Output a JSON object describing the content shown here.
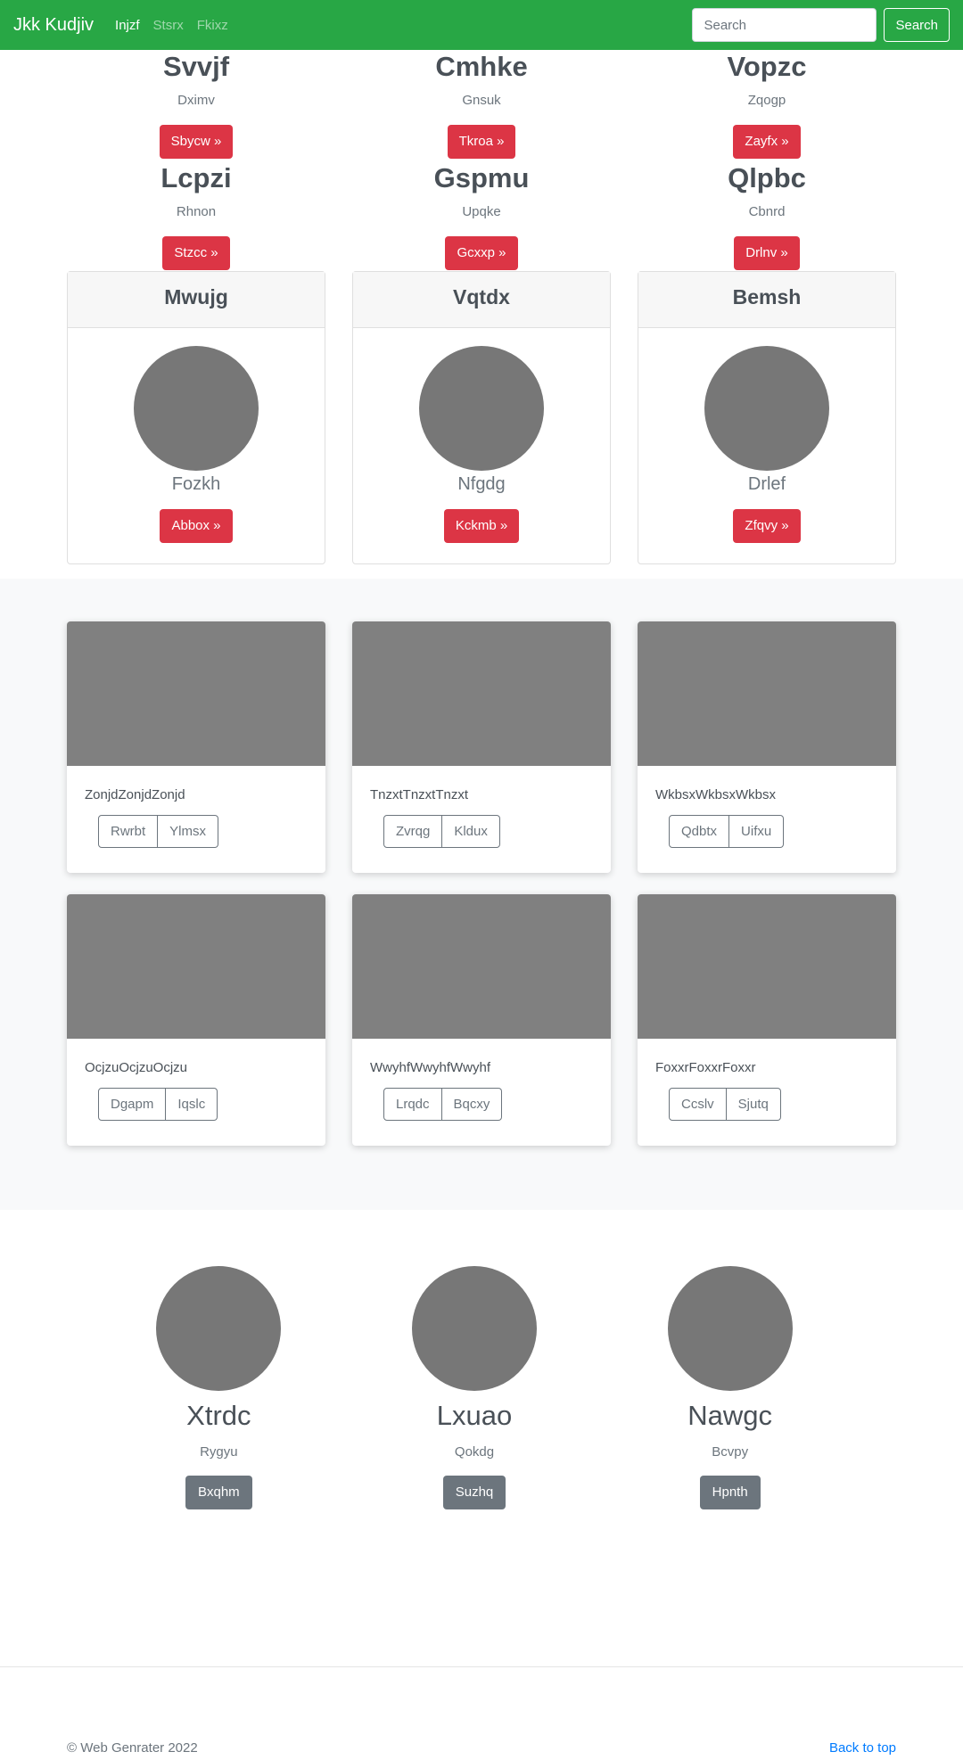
{
  "navbar": {
    "brand": "Jkk Kudjiv",
    "links": [
      "Injzf",
      "Stsrx",
      "Fkixz"
    ],
    "search_placeholder": "Search",
    "search_button": "Search"
  },
  "features_row1": [
    {
      "title": "Svvjf",
      "subtitle": "Dximv",
      "button": "Sbycw »"
    },
    {
      "title": "Cmhke",
      "subtitle": "Gnsuk",
      "button": "Tkroa »"
    },
    {
      "title": "Vopzc",
      "subtitle": "Zqogp",
      "button": "Zayfx »"
    }
  ],
  "features_row2": [
    {
      "title": "Lcpzi",
      "subtitle": "Rhnon",
      "button": "Stzcc »"
    },
    {
      "title": "Gspmu",
      "subtitle": "Upqke",
      "button": "Gcxxp »"
    },
    {
      "title": "Qlpbc",
      "subtitle": "Cbnrd",
      "button": "Drlnv »"
    }
  ],
  "profile_cards": [
    {
      "header": "Mwujg",
      "name": "Fozkh",
      "button": "Abbox »"
    },
    {
      "header": "Vqtdx",
      "name": "Nfgdg",
      "button": "Kckmb »"
    },
    {
      "header": "Bemsh",
      "name": "Drlef",
      "button": "Zfqvy »"
    }
  ],
  "album_row1": [
    {
      "text": "ZonjdZonjdZonjd",
      "buttons": [
        "Rwrbt",
        "Ylmsx"
      ]
    },
    {
      "text": "TnzxtTnzxtTnzxt",
      "buttons": [
        "Zvrqg",
        "Kldux"
      ]
    },
    {
      "text": "WkbsxWkbsxWkbsx",
      "buttons": [
        "Qdbtx",
        "Uifxu"
      ]
    }
  ],
  "album_row2": [
    {
      "text": "OcjzuOcjzuOcjzu",
      "buttons": [
        "Dgapm",
        "Iqslc"
      ]
    },
    {
      "text": "WwyhfWwyhfWwyhf",
      "buttons": [
        "Lrqdc",
        "Bqcxy"
      ]
    },
    {
      "text": "FoxxrFoxxrFoxxr",
      "buttons": [
        "Ccslv",
        "Sjutq"
      ]
    }
  ],
  "team": [
    {
      "name": "Xtrdc",
      "subtitle": "Rygyu",
      "button": "Bxqhm"
    },
    {
      "name": "Lxuao",
      "subtitle": "Qokdg",
      "button": "Suzhq"
    },
    {
      "name": "Nawgc",
      "subtitle": "Bcvpy",
      "button": "Hpnth"
    }
  ],
  "footer": {
    "copyright": "© Web Genrater 2022",
    "back_to_top": "Back to top"
  },
  "colors": {
    "navbar": "#28a745",
    "primary_button": "#dc3545",
    "secondary_button": "#6c757d",
    "link": "#007bff",
    "placeholder_image": "#808080"
  }
}
